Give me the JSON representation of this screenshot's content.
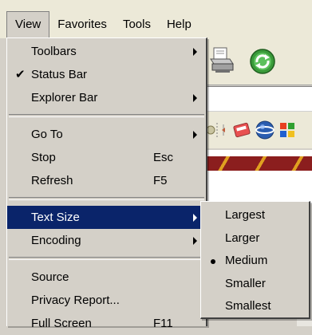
{
  "menubar": {
    "items": [
      {
        "label": "View",
        "active": true
      },
      {
        "label": "Favorites",
        "active": false
      },
      {
        "label": "Tools",
        "active": false
      },
      {
        "label": "Help",
        "active": false
      }
    ]
  },
  "view_menu": {
    "groups": [
      [
        {
          "label": "Toolbars",
          "submenu": true
        },
        {
          "label": "Status Bar",
          "checked": true
        },
        {
          "label": "Explorer Bar",
          "submenu": true
        }
      ],
      [
        {
          "label": "Go To",
          "submenu": true
        },
        {
          "label": "Stop",
          "shortcut": "Esc"
        },
        {
          "label": "Refresh",
          "shortcut": "F5"
        }
      ],
      [
        {
          "label": "Text Size",
          "submenu": true,
          "selected": true
        },
        {
          "label": "Encoding",
          "submenu": true
        }
      ],
      [
        {
          "label": "Source"
        },
        {
          "label": "Privacy Report..."
        },
        {
          "label": "Full Screen",
          "shortcut": "F11"
        }
      ]
    ]
  },
  "text_size_menu": {
    "items": [
      {
        "label": "Largest"
      },
      {
        "label": "Larger"
      },
      {
        "label": "Medium",
        "current": true
      },
      {
        "label": "Smaller"
      },
      {
        "label": "Smallest"
      }
    ]
  },
  "check_glyph": "✔",
  "colors": {
    "menu_bg": "#d4d0c8",
    "menubar_bg": "#ece9d8",
    "highlight": "#0a246a",
    "highlight_text": "#ffffff"
  },
  "icons": [
    "printer-icon",
    "refresh-icon",
    "media-icon",
    "msn-icon",
    "globe-icon",
    "windows-icon"
  ]
}
